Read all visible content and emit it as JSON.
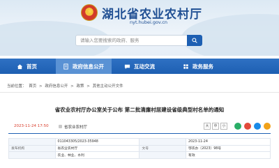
{
  "header": {
    "site_title": "湖北省农业农村厅",
    "site_domain": "nyt.hubei.gov.cn",
    "search_placeholder": "请输入您要搜索的政府、服务"
  },
  "nav": {
    "items": [
      {
        "label": "首页",
        "icon": "home-icon"
      },
      {
        "label": "政府信息公开",
        "icon": "document-icon",
        "active": true
      },
      {
        "label": "互动交流",
        "icon": "chat-icon"
      },
      {
        "label": "政务服务",
        "icon": "service-icon"
      }
    ]
  },
  "breadcrumb": [
    "当前位置：",
    "首页",
    ">",
    "政府信息公开",
    ">",
    "政策",
    ">",
    "其他主动公开文件"
  ],
  "article": {
    "title": "省农业农村厅办公室关于公布 第二批清廉村居建设省级典型村名单的通知",
    "date": "2023-11-24 17:50",
    "source": "省农业农村厅",
    "font_sizes": [
      "大",
      "中",
      "小"
    ],
    "share_colors": [
      "#2aae67",
      "#e24b3b",
      "#1a8be8",
      "#f1a21a"
    ]
  },
  "info_table": {
    "rows": [
      [
        {
          "label": "",
          "value": "011043305/2023-35948"
        },
        {
          "label": "",
          "value": "2023-11-24"
        }
      ],
      [
        {
          "label": "发布机构",
          "value": "省农业农村厅"
        },
        {
          "label": "文号",
          "value": "鄂农办〔2023〕98号"
        }
      ],
      [
        {
          "label": "",
          "value": "农业、林业、水利"
        },
        {
          "label": "",
          "value": "有效"
        }
      ]
    ]
  },
  "colors": {
    "brand_blue": "#1d5fb2",
    "date_red": "#d83c2a"
  }
}
